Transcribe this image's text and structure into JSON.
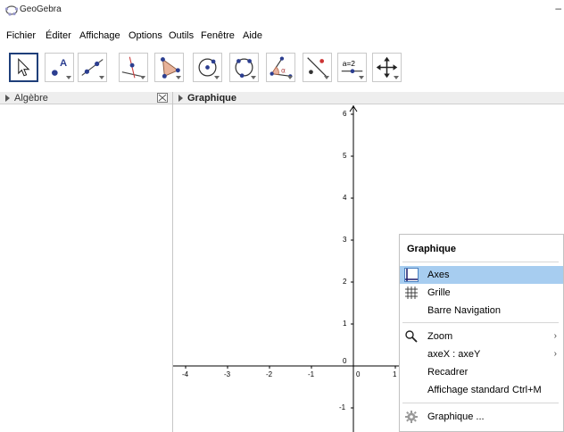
{
  "window": {
    "title": "GeoGebra"
  },
  "menubar": [
    "Fichier",
    "Éditer",
    "Affichage",
    "Options",
    "Outils",
    "Fenêtre",
    "Aide"
  ],
  "toolbar": {
    "tools": [
      {
        "icon": "move-arrow-icon",
        "active": true
      },
      {
        "icon": "point-icon"
      },
      {
        "icon": "line-icon"
      },
      {
        "icon": "perpendicular-line-icon"
      },
      {
        "icon": "polygon-icon"
      },
      {
        "icon": "circle-center-point-icon"
      },
      {
        "icon": "circle-three-points-icon"
      },
      {
        "icon": "angle-icon",
        "glyph": "α"
      },
      {
        "icon": "reflect-line-icon"
      },
      {
        "icon": "slider-icon",
        "glyph": "a=2"
      },
      {
        "icon": "move-graphics-view-icon"
      }
    ]
  },
  "algebra_panel": {
    "title": "Algèbre"
  },
  "graphics_panel": {
    "title": "Graphique",
    "x_ticks": [
      "-4",
      "-3",
      "-2",
      "-1",
      "0",
      "1"
    ],
    "y_ticks": [
      "6",
      "5",
      "4",
      "3",
      "2",
      "1",
      "-1"
    ]
  },
  "context_menu": {
    "title": "Graphique",
    "items": {
      "axes": "Axes",
      "grid": "Grille",
      "nav_bar": "Barre Navigation",
      "zoom": "Zoom",
      "axes_ratio": "axeX : axeY",
      "show_all": "Recadrer",
      "standard_view": "Affichage standard",
      "standard_view_shortcut": "Ctrl+M",
      "properties": "Graphique ..."
    }
  },
  "colors": {
    "highlight": "#a7cdf0",
    "active_tool_border": "#1f3f7a",
    "point_blue": "#2c3e90"
  }
}
